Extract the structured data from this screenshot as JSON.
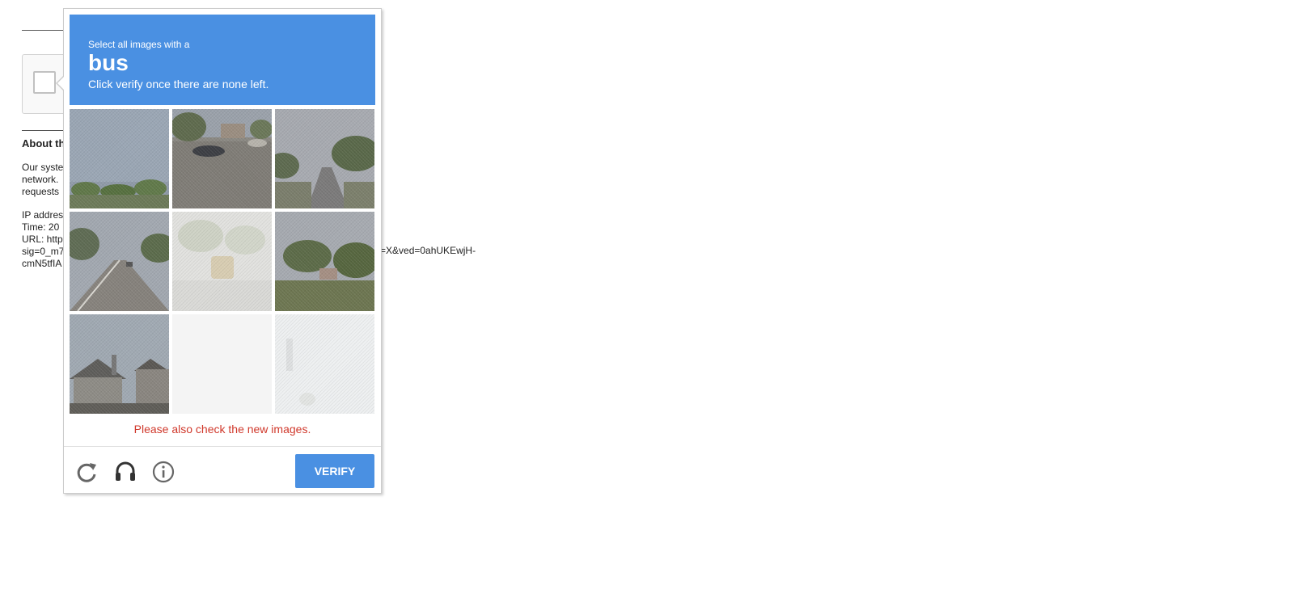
{
  "background_page": {
    "about_title": "About th",
    "paragraph1": [
      "Our syste",
      "network.",
      "requests"
    ],
    "paragraph2": [
      "IP addres",
      "Time: 20",
      "URL: http",
      "sig=0_m7",
      "cmN5tfIA"
    ],
    "url_tail": "=X&ved=0ahUKEwjH-"
  },
  "challenge": {
    "instruction": "Select all images with a",
    "keyword": "bus",
    "hint": "Click verify once there are none left.",
    "error": "Please also check the new images.",
    "verify_label": "VERIFY",
    "tiles": [
      {
        "name": "tile-1",
        "scene": "sky-grass"
      },
      {
        "name": "tile-2",
        "scene": "road-car"
      },
      {
        "name": "tile-3",
        "scene": "road-trees"
      },
      {
        "name": "tile-4",
        "scene": "highway"
      },
      {
        "name": "tile-5",
        "scene": "faded-bus"
      },
      {
        "name": "tile-6",
        "scene": "roadside-trees"
      },
      {
        "name": "tile-7",
        "scene": "house"
      },
      {
        "name": "tile-8",
        "scene": "blank-loading"
      },
      {
        "name": "tile-9",
        "scene": "faded-traffic-light"
      }
    ],
    "icons": [
      "reload-icon",
      "audio-headphones-icon",
      "info-icon"
    ],
    "colors": {
      "header": "#4a90e2",
      "error": "#d0382b",
      "verify": "#4a90e2"
    }
  }
}
